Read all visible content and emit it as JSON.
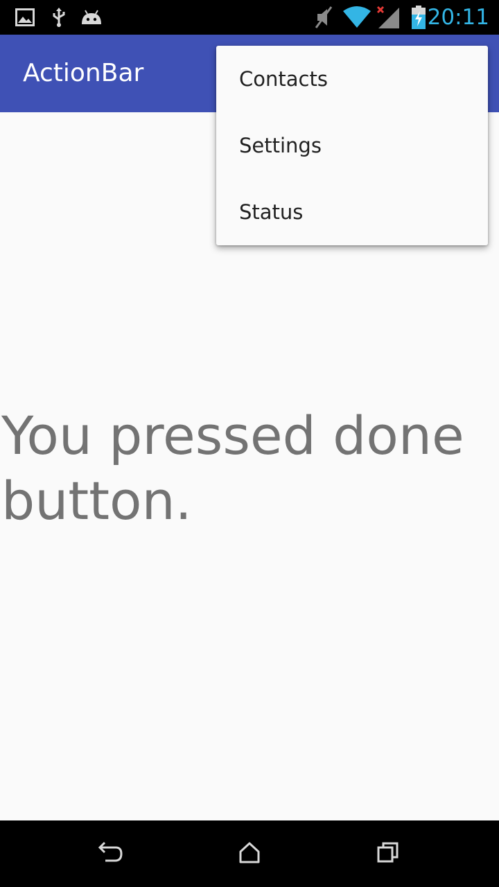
{
  "status_bar": {
    "time": "20:11",
    "icons": [
      "image-icon",
      "usb-icon",
      "android-icon",
      "mute-icon",
      "wifi-icon",
      "signal-icon",
      "battery-charging-icon"
    ],
    "clock_color": "#33b5e5"
  },
  "action_bar": {
    "title": "ActionBar",
    "color": "#3f51b5"
  },
  "overflow_menu": {
    "items": [
      {
        "label": "Contacts"
      },
      {
        "label": "Settings"
      },
      {
        "label": "Status"
      }
    ]
  },
  "content": {
    "message": "You pressed done button."
  },
  "nav_bar": {
    "buttons": [
      "back-icon",
      "home-icon",
      "recents-icon"
    ]
  }
}
